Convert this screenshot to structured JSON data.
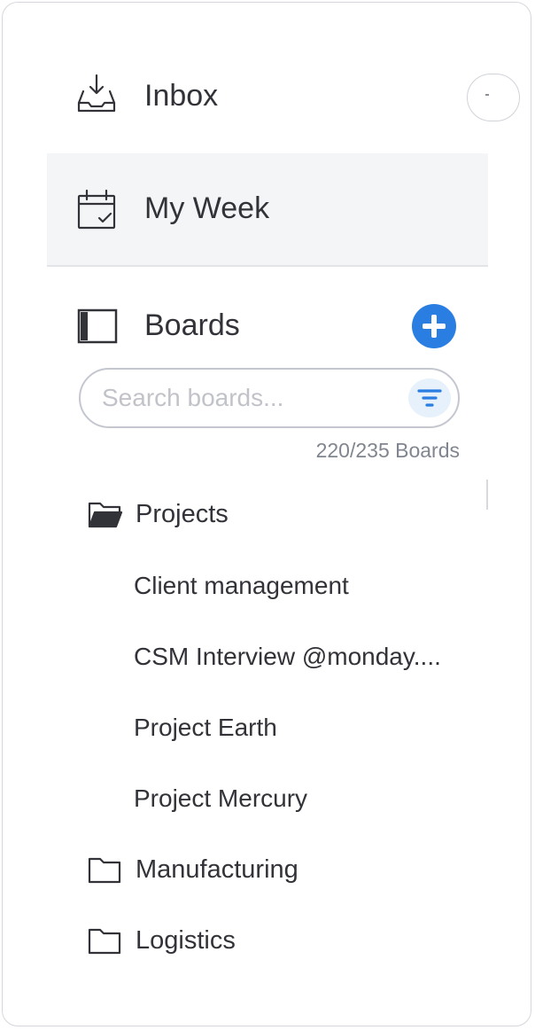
{
  "nav": {
    "inbox_label": "Inbox",
    "my_week_label": "My Week"
  },
  "boards": {
    "label": "Boards",
    "search_placeholder": "Search boards...",
    "count": "220/235 Boards",
    "folders": [
      {
        "name": "Projects",
        "expanded": true,
        "items": [
          "Client management",
          "CSM Interview @monday....",
          "Project Earth",
          "Project Mercury"
        ]
      },
      {
        "name": "Manufacturing",
        "expanded": false,
        "items": []
      },
      {
        "name": "Logistics",
        "expanded": false,
        "items": []
      }
    ]
  },
  "icons": {
    "inbox": "inbox-tray-icon",
    "my_week": "calendar-check-icon",
    "boards": "board-panel-icon",
    "add": "plus-icon",
    "filter": "filter-funnel-icon",
    "folder_open": "folder-open-icon",
    "folder_closed": "folder-icon"
  },
  "colors": {
    "accent": "#2a7de1",
    "selected_row_bg": "#f4f5f7",
    "text": "#323338",
    "muted_text": "#80858f"
  }
}
